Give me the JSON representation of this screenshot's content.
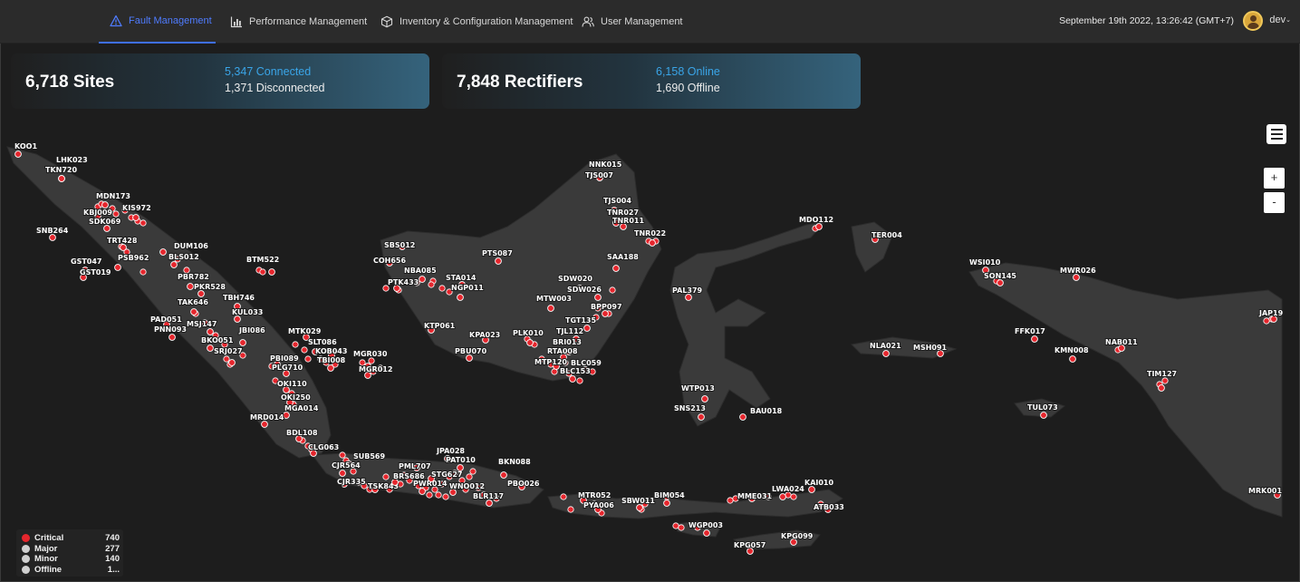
{
  "nav": {
    "tabs": [
      {
        "label": "Fault Management",
        "icon": "warning-triangle-icon",
        "active": true
      },
      {
        "label": "Performance Management",
        "icon": "bar-chart-icon",
        "active": false
      },
      {
        "label": "Inventory & Configuration Management",
        "icon": "cube-icon",
        "active": false
      },
      {
        "label": "User Management",
        "icon": "users-icon",
        "active": false
      }
    ],
    "datetime": "September 19th 2022, 13:26:42 (GMT+7)",
    "user": "dev"
  },
  "cards": {
    "sites": {
      "title": "6,718 Sites",
      "primary": "5,347 Connected",
      "secondary": "1,371 Disconnected"
    },
    "rectifiers": {
      "title": "7,848 Rectifiers",
      "primary": "6,158 Online",
      "secondary": "1,690 Offline"
    }
  },
  "map": {
    "zoom_in": "+",
    "zoom_out": "-",
    "sites": [
      {
        "id": "KOO1"
      },
      {
        "id": "LHK023"
      },
      {
        "id": "TKN720"
      },
      {
        "id": "MDN173"
      },
      {
        "id": "KBJ009"
      },
      {
        "id": "KIS972"
      },
      {
        "id": "SDK069"
      },
      {
        "id": "SNB264"
      },
      {
        "id": "TRT428"
      },
      {
        "id": "DUM106"
      },
      {
        "id": "BLS012"
      },
      {
        "id": "PSB962"
      },
      {
        "id": "GST047"
      },
      {
        "id": "GST019"
      },
      {
        "id": "BTM522"
      },
      {
        "id": "PBR782"
      },
      {
        "id": "PKR528"
      },
      {
        "id": "TBH746"
      },
      {
        "id": "TAK646"
      },
      {
        "id": "KUL033"
      },
      {
        "id": "PAD051"
      },
      {
        "id": "PNN093"
      },
      {
        "id": "MSJ147"
      },
      {
        "id": "JBI086"
      },
      {
        "id": "BKO051"
      },
      {
        "id": "SRJ027"
      },
      {
        "id": "MTK029"
      },
      {
        "id": "SLT086"
      },
      {
        "id": "KOB043"
      },
      {
        "id": "TBI008"
      },
      {
        "id": "MGR030"
      },
      {
        "id": "MGR012"
      },
      {
        "id": "PBI089"
      },
      {
        "id": "PLG710"
      },
      {
        "id": "OKI110"
      },
      {
        "id": "OKI250"
      },
      {
        "id": "MGA014"
      },
      {
        "id": "MRD014"
      },
      {
        "id": "BDL108"
      },
      {
        "id": "CLG063"
      },
      {
        "id": "SUB569"
      },
      {
        "id": "CJR564"
      },
      {
        "id": "CJR335"
      },
      {
        "id": "TSK843"
      },
      {
        "id": "BRS686"
      },
      {
        "id": "PML707"
      },
      {
        "id": "PWR014"
      },
      {
        "id": "STG627"
      },
      {
        "id": "JPA028"
      },
      {
        "id": "PAT010"
      },
      {
        "id": "WNO012"
      },
      {
        "id": "BLR117"
      },
      {
        "id": "BKN088"
      },
      {
        "id": "PBO026"
      },
      {
        "id": "SBS012"
      },
      {
        "id": "COH656"
      },
      {
        "id": "NBA085"
      },
      {
        "id": "PTK433"
      },
      {
        "id": "STA014"
      },
      {
        "id": "NGP011"
      },
      {
        "id": "PTS087"
      },
      {
        "id": "KTP061"
      },
      {
        "id": "KPA023"
      },
      {
        "id": "PBU070"
      },
      {
        "id": "PLK010"
      },
      {
        "id": "NNK015"
      },
      {
        "id": "TJS007"
      },
      {
        "id": "TJS004"
      },
      {
        "id": "TNR027"
      },
      {
        "id": "TNR011"
      },
      {
        "id": "TNR022"
      },
      {
        "id": "SAA188"
      },
      {
        "id": "SDW020"
      },
      {
        "id": "SDW026"
      },
      {
        "id": "MTW003"
      },
      {
        "id": "BPP097"
      },
      {
        "id": "TGT135"
      },
      {
        "id": "TJL112"
      },
      {
        "id": "BRI013"
      },
      {
        "id": "RTA008"
      },
      {
        "id": "MTP120"
      },
      {
        "id": "BLC059"
      },
      {
        "id": "BLC153"
      },
      {
        "id": "MDO112"
      },
      {
        "id": "PAL379"
      },
      {
        "id": "WTP013"
      },
      {
        "id": "SNS213"
      },
      {
        "id": "BAU018"
      },
      {
        "id": "TER004"
      },
      {
        "id": "WSI010"
      },
      {
        "id": "SON145"
      },
      {
        "id": "MWR026"
      },
      {
        "id": "JAP19"
      },
      {
        "id": "FFK017"
      },
      {
        "id": "NLA021"
      },
      {
        "id": "MSH091"
      },
      {
        "id": "KMN008"
      },
      {
        "id": "NAB011"
      },
      {
        "id": "TIM127"
      },
      {
        "id": "TUL073"
      },
      {
        "id": "MRK001"
      },
      {
        "id": "MTR052"
      },
      {
        "id": "PYA006"
      },
      {
        "id": "SBW011"
      },
      {
        "id": "BIM054"
      },
      {
        "id": "MME031"
      },
      {
        "id": "LWA024"
      },
      {
        "id": "KAI010"
      },
      {
        "id": "ATB033"
      },
      {
        "id": "WGP003"
      },
      {
        "id": "KPG057"
      },
      {
        "id": "KPG099"
      }
    ]
  },
  "legend": [
    {
      "name": "Critical",
      "count": "740",
      "color": "#e5262d"
    },
    {
      "name": "Major",
      "count": "277",
      "color": "#d0d0d0"
    },
    {
      "name": "Minor",
      "count": "140",
      "color": "#d0d0d0"
    },
    {
      "name": "Offline",
      "count": "1...",
      "color": "#d0d0d0"
    }
  ]
}
